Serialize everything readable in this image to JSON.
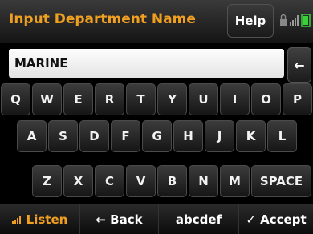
{
  "header": {
    "title": "Input Department Name",
    "help_label": "Help"
  },
  "input": {
    "value": "MARINE",
    "backspace_glyph": "←"
  },
  "keyboard": {
    "row1": [
      "Q",
      "W",
      "E",
      "R",
      "T",
      "Y",
      "U",
      "I",
      "O",
      "P"
    ],
    "row2": [
      "A",
      "S",
      "D",
      "F",
      "G",
      "H",
      "J",
      "K",
      "L"
    ],
    "row3": [
      "Z",
      "X",
      "C",
      "V",
      "B",
      "N",
      "M"
    ],
    "space_label": "SPACE"
  },
  "bottom_bar": {
    "listen_label": "Listen",
    "back_label": "← Back",
    "mode_label": "abcdef",
    "accept_label": "✓ Accept"
  },
  "colors": {
    "accent": "#f0a020",
    "battery": "#3ccf3c"
  }
}
